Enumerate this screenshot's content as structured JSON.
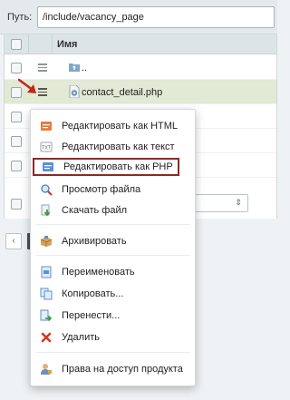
{
  "path_bar": {
    "label": "Путь:",
    "value": "/include/vacancy_page"
  },
  "grid": {
    "column_name": "Имя",
    "rows": [
      {
        "name": "..",
        "type": "folder"
      },
      {
        "name": "contact_detail.php",
        "type": "php-file"
      }
    ]
  },
  "menu": {
    "items": [
      {
        "label": "Редактировать как HTML",
        "icon": "edit-html-icon"
      },
      {
        "label": "Редактировать как текст",
        "icon": "edit-text-icon"
      },
      {
        "label": "Редактировать как PHP",
        "icon": "edit-php-icon"
      },
      {
        "label": "Просмотр файла",
        "icon": "view-file-icon"
      },
      {
        "label": "Скачать файл",
        "icon": "download-icon"
      },
      {
        "label": "Архивировать",
        "icon": "archive-icon"
      },
      {
        "label": "Переименовать",
        "icon": "rename-icon"
      },
      {
        "label": "Копировать...",
        "icon": "copy-icon"
      },
      {
        "label": "Перенести...",
        "icon": "move-icon"
      },
      {
        "label": "Удалить",
        "icon": "delete-icon"
      },
      {
        "label": "Права на доступ продукта",
        "icon": "access-rights-icon"
      }
    ]
  },
  "colors": {
    "highlight_border": "#8c2a2a",
    "selected_row": "#e2e9d4"
  }
}
